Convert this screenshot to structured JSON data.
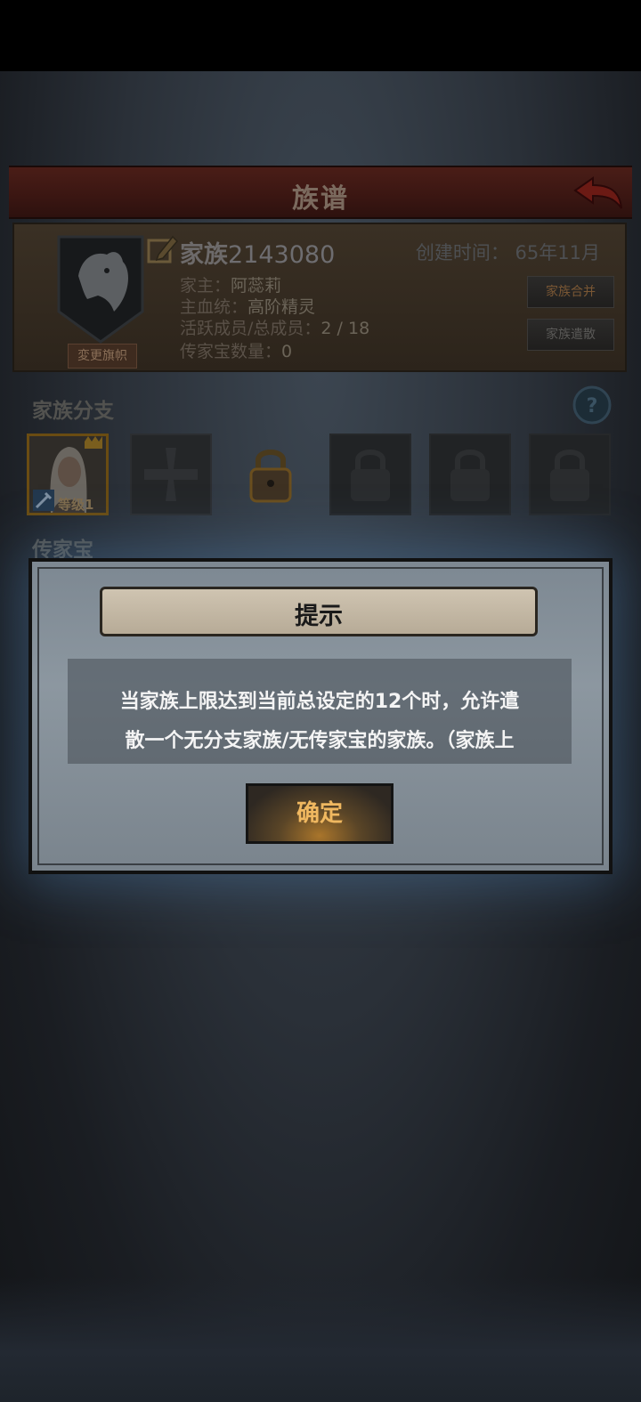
{
  "header": {
    "title": "族谱"
  },
  "family": {
    "name_prefix": "家族",
    "name_number": "2143080",
    "created_label": "创建时间：",
    "created_value": "65年11月",
    "change_flag": "変更旗帜",
    "leader_label": "家主：",
    "leader_value": "阿蕊莉",
    "bloodline_label": "主血统：",
    "bloodline_value": "高阶精灵",
    "members_label": "活跃成员/总成员：",
    "members_value": "2 / 18",
    "heirloom_label": "传家宝数量：",
    "heirloom_value": "0",
    "merge_button": "家族合并",
    "disband_button": "家族遣散"
  },
  "branch": {
    "title": "家族分支",
    "level_label": "等级1"
  },
  "heirloom_section": {
    "title": "传家宝"
  },
  "dialog": {
    "title": "提示",
    "message_line1": "当家族上限达到当前总设定的12个时，允许遣",
    "message_line2": "散一个无分支家族/无传家宝的家族。（家族上",
    "confirm": "确定"
  },
  "colors": {
    "accent_gold": "#f0b860",
    "header_red": "#4a1d17",
    "dialog_bg": "#8c97a0"
  }
}
